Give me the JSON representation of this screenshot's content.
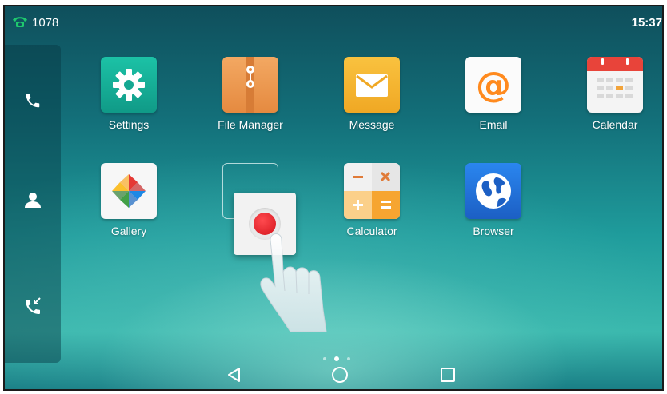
{
  "status_bar": {
    "extension": "1078",
    "time": "15:37",
    "phone_icon_color": "#1fc86e"
  },
  "side_rail": {
    "items": [
      {
        "name": "call",
        "icon": "phone-icon"
      },
      {
        "name": "contacts",
        "icon": "person-icon"
      },
      {
        "name": "call-history",
        "icon": "call-history-icon"
      }
    ]
  },
  "apps": {
    "settings": {
      "label": "Settings",
      "icon": "gear-icon",
      "color": "#16b39b"
    },
    "file_manager": {
      "label": "File Manager",
      "icon": "folder-icon",
      "color": "#ee9a52"
    },
    "message": {
      "label": "Message",
      "icon": "envelope-icon",
      "color": "#f5b52e"
    },
    "email": {
      "label": "Email",
      "icon": "at-sign-icon",
      "color": "#ff8a1e"
    },
    "calendar": {
      "label": "Calendar",
      "icon": "calendar-icon",
      "color": "#e8443a"
    },
    "gallery": {
      "label": "Gallery",
      "icon": "pinwheel-icon"
    },
    "calculator": {
      "label": "Calculator",
      "icon": "calculator-icon",
      "color": "#f6a531"
    },
    "browser": {
      "label": "Browser",
      "icon": "globe-icon",
      "color": "#1e6fd9"
    }
  },
  "overlay": {
    "drop_target": "empty-slot",
    "record_button_color": "#e5212b",
    "hand_icon": "tap-hand-icon"
  },
  "page_indicator": {
    "pages": 3,
    "current": 2
  },
  "nav_bar": {
    "items": [
      {
        "name": "back",
        "icon": "back-triangle-icon"
      },
      {
        "name": "home",
        "icon": "home-circle-icon"
      },
      {
        "name": "recents",
        "icon": "recents-square-icon"
      }
    ]
  }
}
